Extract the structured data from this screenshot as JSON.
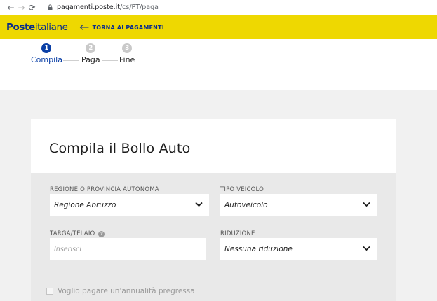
{
  "browser": {
    "url_host": "pagamenti.poste.it",
    "url_path": "/cs/PT/paga"
  },
  "header": {
    "logo_bold": "Poste",
    "logo_regular": "italiane",
    "back_label": "TORNA AI PAGAMENTI",
    "bg_color": "#eed801",
    "brand_color": "#0a2d8a"
  },
  "stepper": {
    "steps": [
      {
        "num": "1",
        "label": "Compila",
        "active": true
      },
      {
        "num": "2",
        "label": "Paga",
        "active": false
      },
      {
        "num": "3",
        "label": "Fine",
        "active": false
      }
    ],
    "active_color": "#0a3fa6"
  },
  "form": {
    "title": "Compila il Bollo Auto",
    "region": {
      "label": "REGIONE O PROVINCIA AUTONOMA",
      "value": "Regione Abruzzo"
    },
    "vehicle": {
      "label": "TIPO VEICOLO",
      "value": "Autoveicolo"
    },
    "plate": {
      "label": "TARGA/TELAIO",
      "placeholder": "Inserisci"
    },
    "reduction": {
      "label": "RIDUZIONE",
      "value": "Nessuna riduzione"
    },
    "arrears_checkbox": {
      "label": "Voglio pagare un'annualità pregressa",
      "checked": false
    }
  }
}
